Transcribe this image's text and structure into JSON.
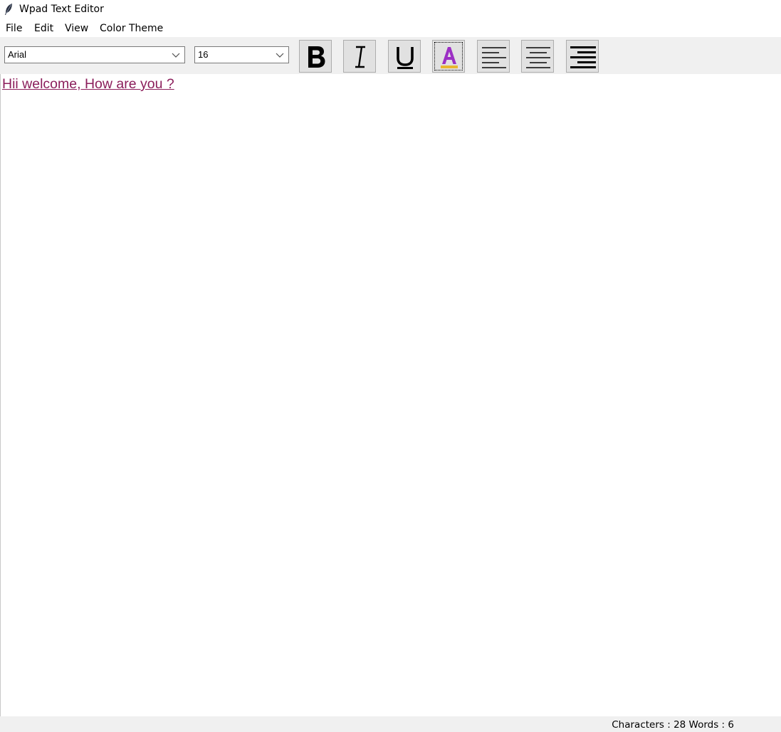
{
  "window": {
    "title": "Wpad Text Editor",
    "icon": "feather-icon"
  },
  "menubar": {
    "items": [
      "File",
      "Edit",
      "View",
      "Color Theme"
    ]
  },
  "toolbar": {
    "font_family": "Arial",
    "font_size": "16",
    "buttons": [
      {
        "name": "bold-button",
        "icon": "bold-icon",
        "label": "B"
      },
      {
        "name": "italic-button",
        "icon": "italic-icon",
        "label": "I"
      },
      {
        "name": "underline-button",
        "icon": "underline-icon",
        "label": "U"
      },
      {
        "name": "font-color-button",
        "icon": "font-color-icon",
        "label": "A"
      },
      {
        "name": "align-left-button",
        "icon": "align-left-icon"
      },
      {
        "name": "align-center-button",
        "icon": "align-center-icon"
      },
      {
        "name": "align-right-button",
        "icon": "align-right-icon"
      }
    ],
    "font_color_accent": "#9b2fc4",
    "font_color_underline": "#e8b630"
  },
  "editor": {
    "text": "Hii welcome, How are you ?",
    "text_color": "#8b1e5b"
  },
  "statusbar": {
    "text": "Characters : 28 Words : 6"
  }
}
